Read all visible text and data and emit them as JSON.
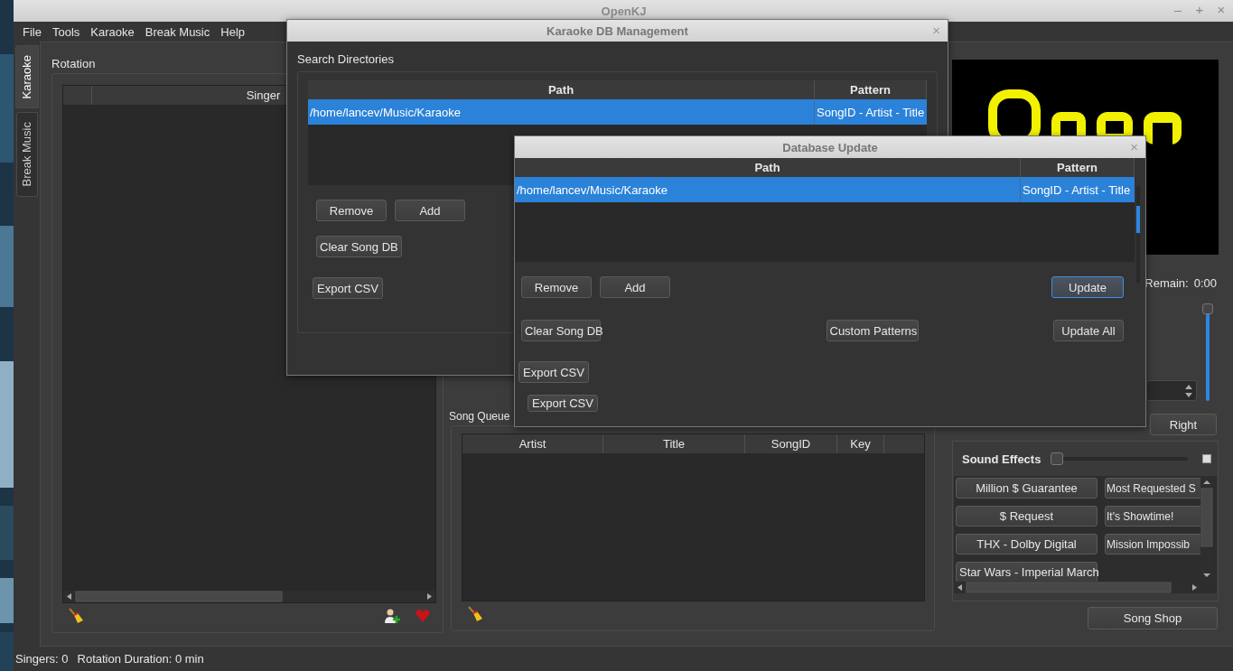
{
  "window": {
    "title": "OpenKJ",
    "controls": [
      "–",
      "+",
      "×"
    ]
  },
  "menu": [
    {
      "label": "File"
    },
    {
      "label": "Tools"
    },
    {
      "label": "Karaoke"
    },
    {
      "label": "Break Music"
    },
    {
      "label": "Help"
    }
  ],
  "side_tabs": [
    {
      "label": "Karaoke",
      "selected": true
    },
    {
      "label": "Break Music",
      "selected": false
    }
  ],
  "rotation": {
    "title": "Rotation",
    "columns": [
      "Singer"
    ]
  },
  "song_queue": {
    "title": "Song Queue",
    "columns": [
      "Artist",
      "Title",
      "SongID",
      "Key"
    ]
  },
  "player": {
    "remain_label": "Remain:",
    "remain_value": "0:00",
    "volume": {
      "level": 1
    }
  },
  "multiplex_buttons": [
    {
      "label": "Right"
    }
  ],
  "sound_effects": {
    "title": "Sound Effects",
    "level": 0,
    "buttons": [
      "Million $ Guarantee",
      "Most Requested S",
      "$ Request",
      "It's Showtime!",
      "THX - Dolby Digital",
      "Mission Impossib",
      "Star Wars - Imperial March"
    ]
  },
  "song_shop": "Song Shop",
  "status_bar": {
    "singers": "Singers: 0",
    "duration": "Rotation Duration: 0 min"
  },
  "db_management": {
    "title": "Karaoke DB Management",
    "close": "×",
    "section": "Search Directories",
    "columns": [
      "Path",
      "Pattern"
    ],
    "rows": [
      {
        "path": "/home/lancev/Music/Karaoke",
        "pattern": "SongID - Artist - Title",
        "selected": true
      }
    ],
    "buttons": [
      "Remove",
      "Add",
      "Clear Song DB",
      "Export CSV"
    ]
  },
  "db_update": {
    "title": "Database Update",
    "close": "×",
    "columns": [
      "Path",
      "Pattern"
    ],
    "rows": [
      {
        "path": "/home/lancev/Music/Karaoke",
        "pattern": "SongID - Artist - Title",
        "selected": true
      }
    ],
    "buttons": [
      {
        "label": "Remove",
        "focused": false
      },
      {
        "label": "Add",
        "focused": false
      },
      {
        "label": "Update",
        "focused": true
      },
      {
        "label": "Clear Song DB",
        "focused": false
      },
      {
        "label": "Custom Patterns",
        "focused": false
      },
      {
        "label": "Update All",
        "focused": false
      },
      {
        "label": "Export CSV",
        "focused": false
      },
      {
        "label": "Export CSV",
        "focused": false
      }
    ]
  }
}
